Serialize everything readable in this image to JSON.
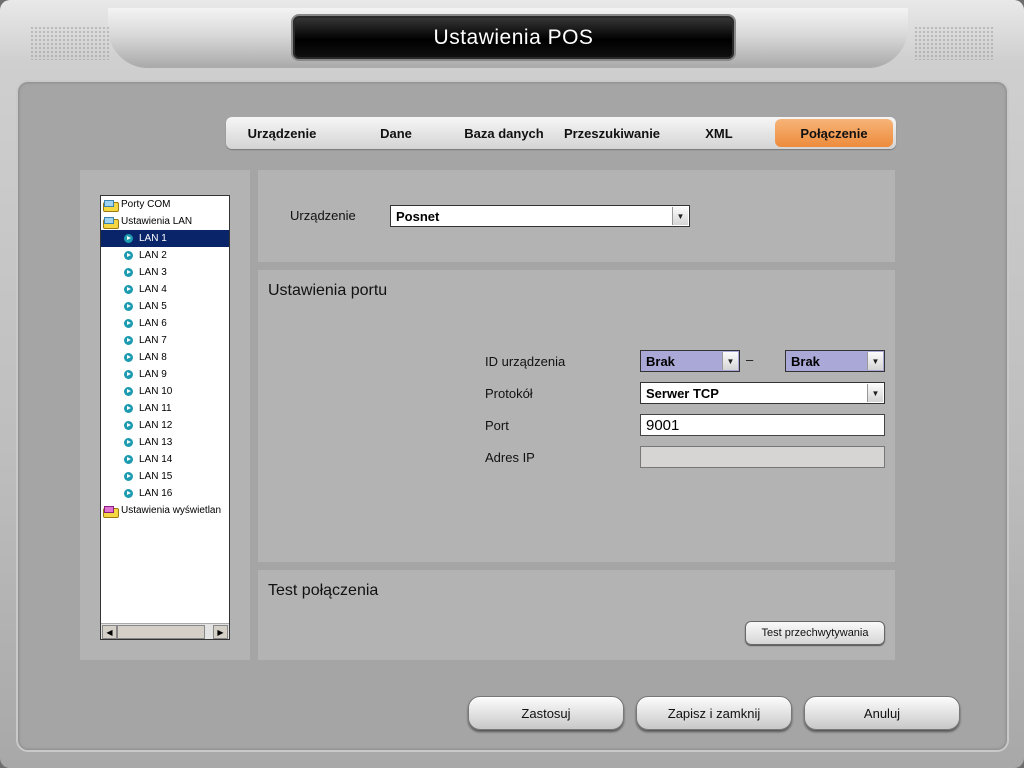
{
  "window": {
    "title": "Ustawienia POS"
  },
  "tabs": [
    {
      "label": "Urządzenie"
    },
    {
      "label": "Dane"
    },
    {
      "label": "Baza danych"
    },
    {
      "label": "Przeszukiwanie"
    },
    {
      "label": "XML"
    },
    {
      "label": "Połączenie",
      "active": true
    }
  ],
  "tree": {
    "ports_label": "Porty COM",
    "lan_label": "Ustawienia LAN",
    "lan_items": [
      "LAN 1",
      "LAN 2",
      "LAN 3",
      "LAN 4",
      "LAN 5",
      "LAN 6",
      "LAN 7",
      "LAN 8",
      "LAN 9",
      "LAN 10",
      "LAN 11",
      "LAN 12",
      "LAN 13",
      "LAN 14",
      "LAN 15",
      "LAN 16"
    ],
    "selected": "LAN 1",
    "display_label": "Ustawienia wyświetlan"
  },
  "device": {
    "label": "Urządzenie",
    "value": "Posnet"
  },
  "port_settings": {
    "title": "Ustawienia portu",
    "device_id_label": "ID urządzenia",
    "device_id_from": "Brak",
    "device_id_separator": "–",
    "device_id_to": "Brak",
    "protocol_label": "Protokół",
    "protocol_value": "Serwer TCP",
    "port_label": "Port",
    "port_value": "9001",
    "ip_label": "Adres IP",
    "ip_value": ""
  },
  "connection_test": {
    "title": "Test połączenia",
    "button": "Test przechwytywania"
  },
  "footer": {
    "apply": "Zastosuj",
    "save_close": "Zapisz i zamknij",
    "cancel": "Anuluj"
  },
  "colors": {
    "active_tab": "#ed8b3b",
    "selection": "#0a246a",
    "id_combo": "#a9a8d6"
  }
}
